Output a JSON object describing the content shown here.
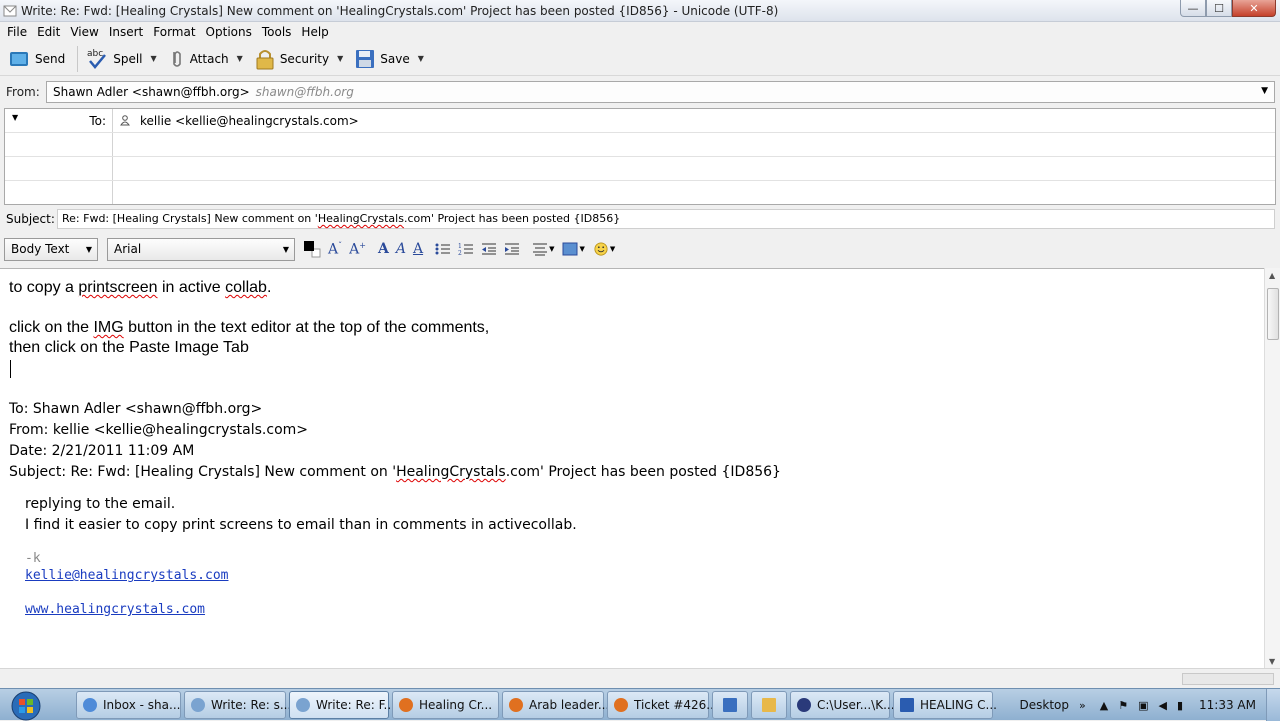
{
  "window": {
    "title": "Write: Re: Fwd: [Healing Crystals] New comment on 'HealingCrystals.com' Project has been posted {ID856} - Unicode (UTF-8)",
    "min_label": "—",
    "max_label": "☐",
    "close_label": "✕"
  },
  "menu": [
    "File",
    "Edit",
    "View",
    "Insert",
    "Format",
    "Options",
    "Tools",
    "Help"
  ],
  "toolbar": {
    "send": "Send",
    "spell": "Spell",
    "attach": "Attach",
    "security": "Security",
    "save": "Save"
  },
  "from": {
    "label": "From:",
    "value": "Shawn Adler <shawn@ffbh.org>",
    "ghost": "shawn@ffbh.org"
  },
  "recipients": {
    "type_label": "To:",
    "to_value": "kellie <kellie@healingcrystals.com>"
  },
  "subject": {
    "label": "Subject:",
    "pre": "Re: Fwd: [Healing Crystals] New comment on '",
    "misspelled": "HealingCrystals",
    "post": ".com' Project  has been posted {ID856}"
  },
  "format": {
    "paragraph_style": "Body Text",
    "font": "Arial"
  },
  "body": {
    "line1_a": "to copy a ",
    "line1_b": "printscreen",
    "line1_c": " in active ",
    "line1_d": "collab",
    "line1_e": ".",
    "line2_a": "click on the ",
    "line2_b": "IMG",
    "line2_c": " button in the text editor at the top of the comments,",
    "line3": "then click on the Paste Image Tab",
    "quoted_to": "To: Shawn Adler <shawn@ffbh.org>",
    "quoted_from": "From: kellie <kellie@healingcrystals.com>",
    "quoted_date": "Date: 2/21/2011 11:09 AM",
    "quoted_subject_pre": "Subject: Re: Fwd: [Healing Crystals] New comment on '",
    "quoted_subject_mis": "HealingCrystals",
    "quoted_subject_post": ".com' Project  has been posted {ID856}",
    "reply1": "replying to the email.",
    "reply2": "I find it easier to copy print screens to email than in comments in activecollab.",
    "sig": "-k",
    "email_link": "kellie@healingcrystals.com",
    "web_link": "www.healingcrystals.com"
  },
  "taskbar": {
    "tasks": [
      {
        "label": "Inbox - sha...",
        "color": "#4f8bd8"
      },
      {
        "label": "Write: Re: s...",
        "color": "#7aa3d0"
      },
      {
        "label": "Write: Re: F...",
        "color": "#7aa3d0"
      },
      {
        "label": "Healing Cr...",
        "color": "#e07020"
      },
      {
        "label": "Arab leader...",
        "color": "#e07020"
      },
      {
        "label": "Ticket #426...",
        "color": "#e07020"
      },
      {
        "label": "",
        "color": "#3a6fbf"
      },
      {
        "label": "",
        "color": "#e8b84a"
      },
      {
        "label": "C:\\User...\\K...",
        "color": "#2a3a7a"
      },
      {
        "label": "HEALING C...",
        "color": "#2a5cb0"
      }
    ],
    "desktop": "Desktop",
    "chevron": "»",
    "clock": "11:33 AM"
  }
}
